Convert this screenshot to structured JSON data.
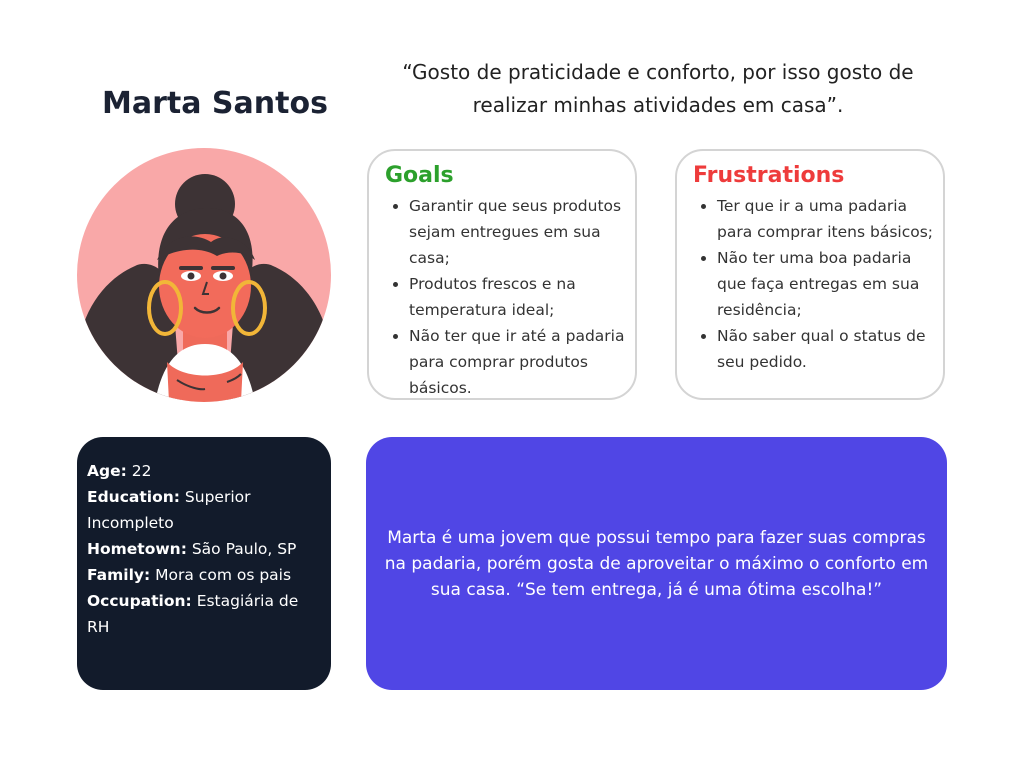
{
  "persona": {
    "name": "Marta Santos",
    "quote": "“Gosto de praticidade e conforto, por isso gosto de realizar minhas atividades em casa”."
  },
  "goals": {
    "title": "Goals",
    "items": [
      "Garantir que seus produtos sejam entregues em sua casa;",
      "Produtos frescos e na temperatura ideal;",
      "Não ter que ir até a padaria para comprar produtos básicos."
    ]
  },
  "frustrations": {
    "title": "Frustrations",
    "items": [
      "Ter que ir a uma padaria para comprar itens básicos;",
      "Não ter uma boa padaria que faça entregas em sua residência;",
      "Não saber qual o status de seu pedido."
    ]
  },
  "info": {
    "age_label": "Age:",
    "age_value": "22",
    "education_label": "Education:",
    "education_value": "Superior Incompleto",
    "hometown_label": "Hometown:",
    "hometown_value": "São Paulo, SP",
    "family_label": "Family:",
    "family_value": "Mora com os pais",
    "occupation_label": "Occupation:",
    "occupation_value": "Estagiária de RH"
  },
  "bio": {
    "text": "Marta é uma jovem que possui tempo para fazer suas compras na padaria, porém gosta de aproveitar o máximo o conforto em sua casa. “Se tem entrega, já é uma ótima escolha!”"
  },
  "colors": {
    "goals_title": "#2ca02c",
    "frustrations_title": "#ee3b3b",
    "info_bg": "#121b2b",
    "bio_bg": "#5046e5",
    "avatar_bg": "#f9a8a8"
  },
  "icons": {
    "avatar": "woman-portrait-illustration"
  }
}
